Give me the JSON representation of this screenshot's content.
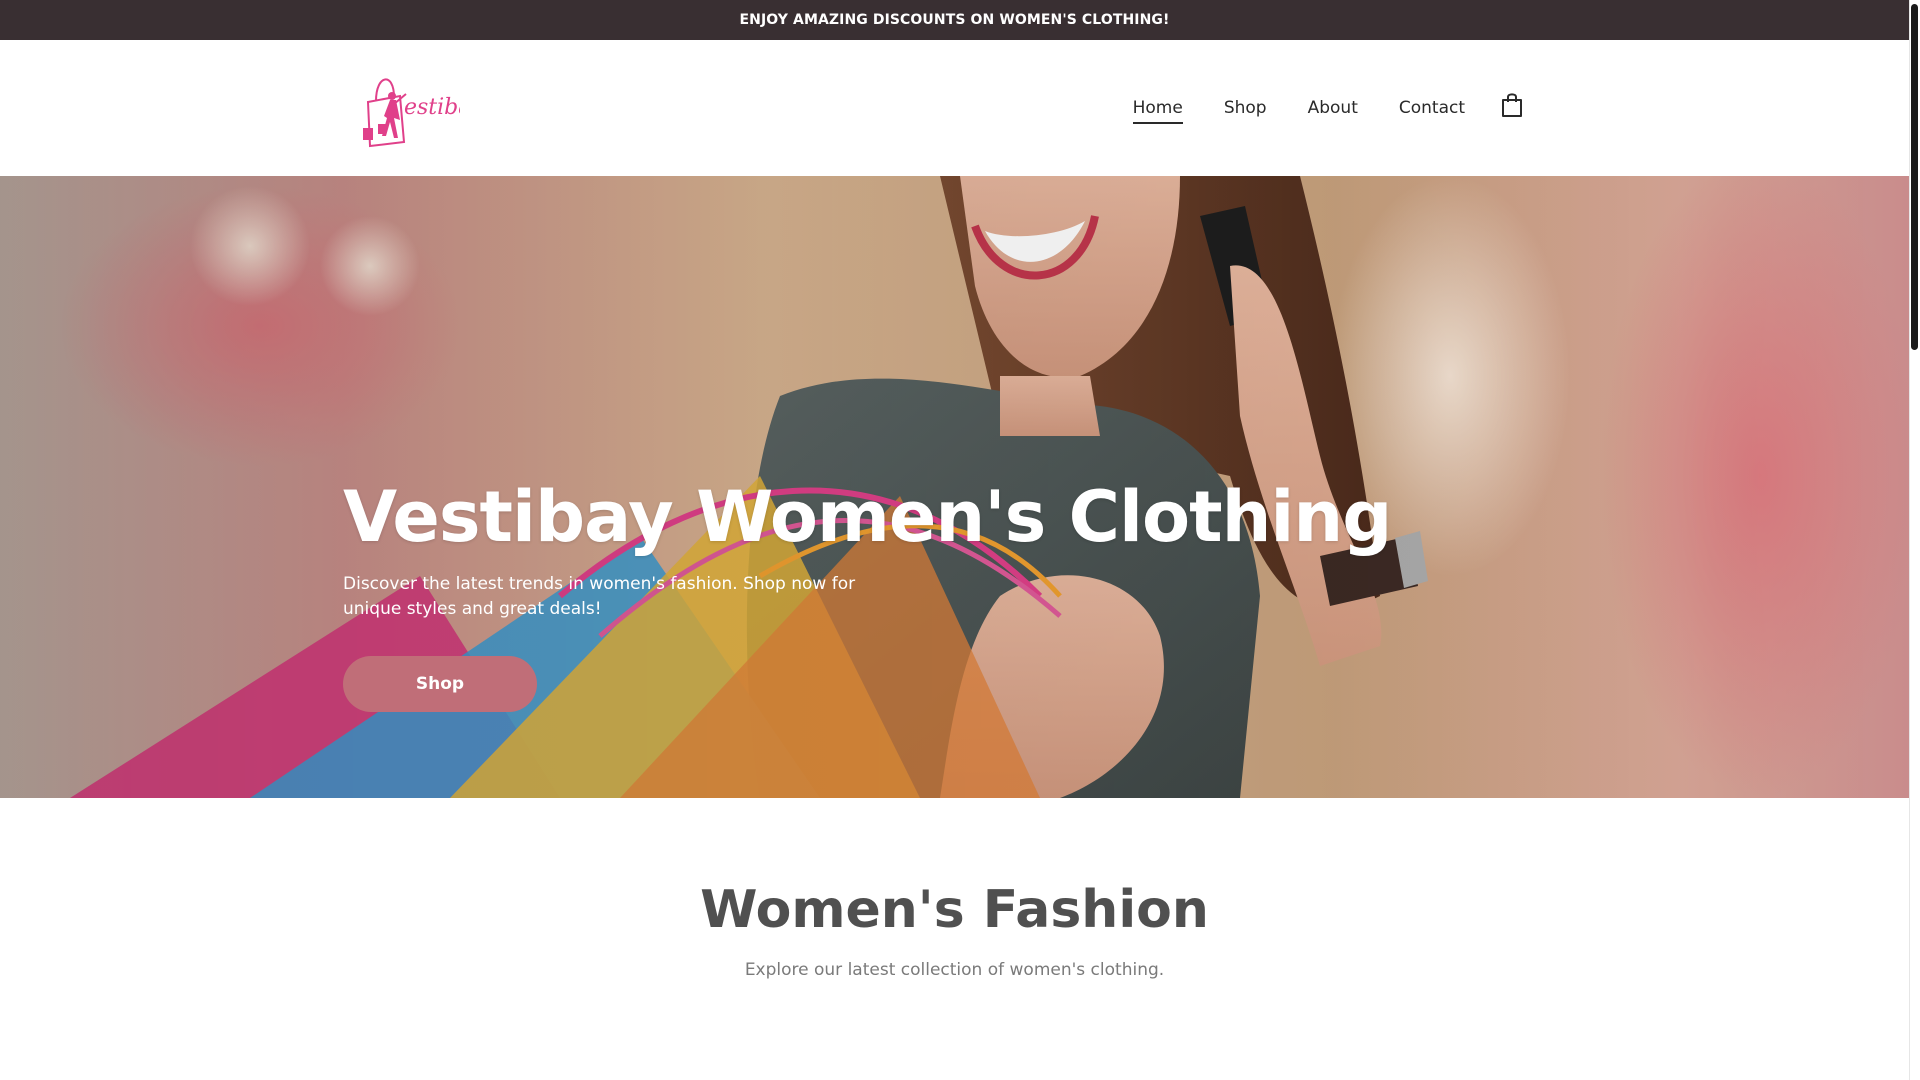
{
  "announcement": {
    "text": "ENJOY AMAZING DISCOUNTS ON WOMEN'S CLOTHING!"
  },
  "header": {
    "logo_text": "estibay",
    "nav": [
      {
        "label": "Home",
        "active": true
      },
      {
        "label": "Shop",
        "active": false
      },
      {
        "label": "About",
        "active": false
      },
      {
        "label": "Contact",
        "active": false
      }
    ],
    "cart_icon": "shopping-bag-icon"
  },
  "hero": {
    "title": "Vestibay Women's Clothing",
    "subtitle": "Discover the latest trends in women's fashion. Shop now for unique styles and great deals!",
    "button_label": "Shop",
    "button_color": "#c06e78"
  },
  "section": {
    "title": "Women's Fashion",
    "subtitle": "Explore our latest collection of women's clothing."
  },
  "colors": {
    "topbar_bg": "#392f32",
    "brand_pink": "#e0408a",
    "accent": "#c06e78"
  }
}
